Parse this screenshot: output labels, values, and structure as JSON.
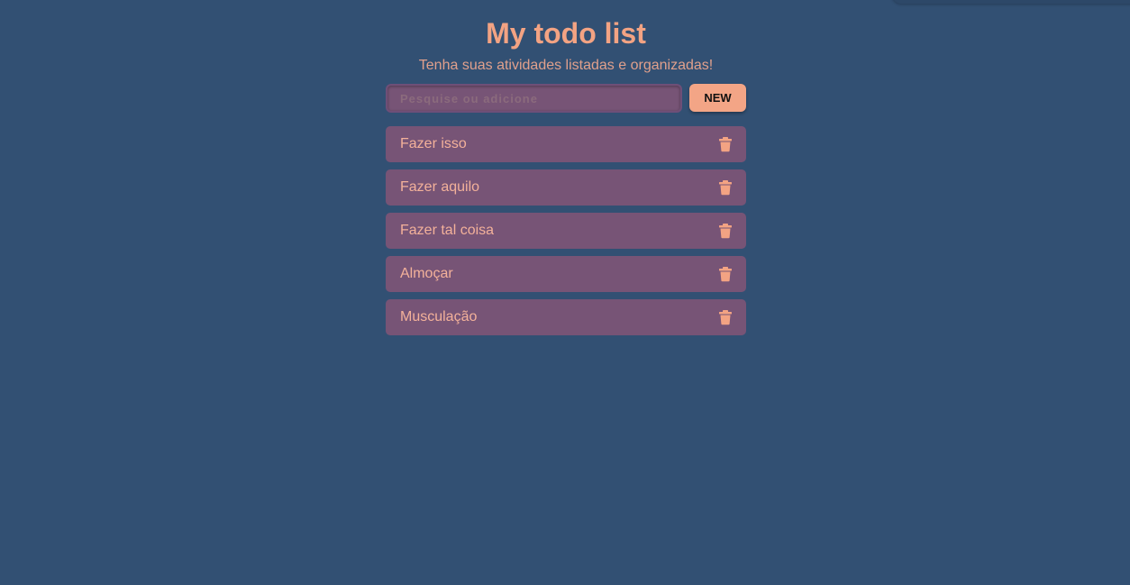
{
  "header": {
    "title": "My todo list",
    "subtitle": "Tenha suas atividades listadas e organizadas!"
  },
  "search": {
    "placeholder": "Pesquise ou adicione",
    "value": "",
    "new_label": "NEW"
  },
  "todos": [
    {
      "label": "Fazer isso",
      "icon": "trash-icon"
    },
    {
      "label": "Fazer aquilo",
      "icon": "trash-icon"
    },
    {
      "label": "Fazer tal coisa",
      "icon": "trash-icon"
    },
    {
      "label": "Almoçar",
      "icon": "trash-icon"
    },
    {
      "label": "Musculação",
      "icon": "trash-icon"
    }
  ],
  "colors": {
    "background": "#325073",
    "accent": "#f3a383",
    "item_background": "#775476",
    "item_text": "#f3b19a"
  }
}
